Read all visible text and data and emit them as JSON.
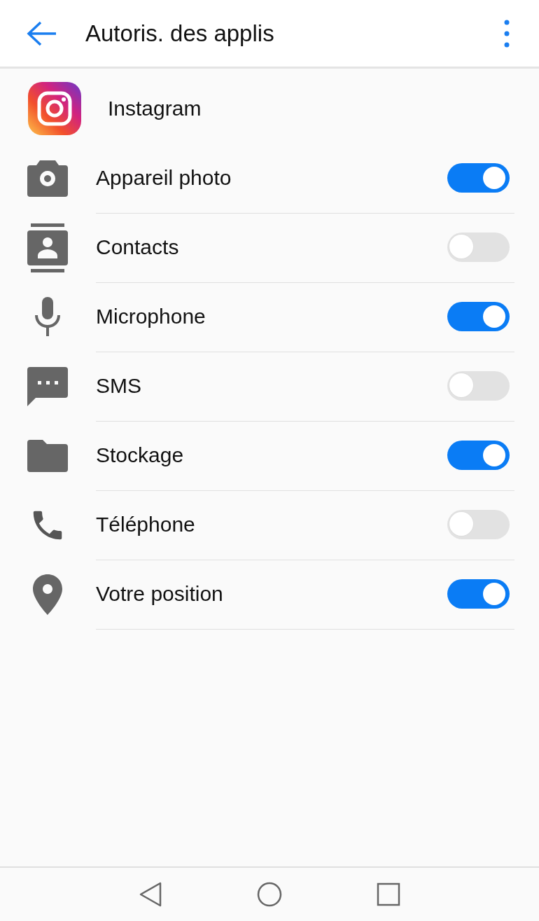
{
  "header": {
    "title": "Autoris. des applis"
  },
  "app": {
    "name": "Instagram"
  },
  "permissions": [
    {
      "kind": "camera",
      "label": "Appareil photo",
      "on": true
    },
    {
      "kind": "contacts",
      "label": "Contacts",
      "on": false
    },
    {
      "kind": "microphone",
      "label": "Microphone",
      "on": true
    },
    {
      "kind": "sms",
      "label": "SMS",
      "on": false
    },
    {
      "kind": "storage",
      "label": "Stockage",
      "on": true
    },
    {
      "kind": "phone",
      "label": "Téléphone",
      "on": false
    },
    {
      "kind": "location",
      "label": "Votre position",
      "on": true
    }
  ]
}
